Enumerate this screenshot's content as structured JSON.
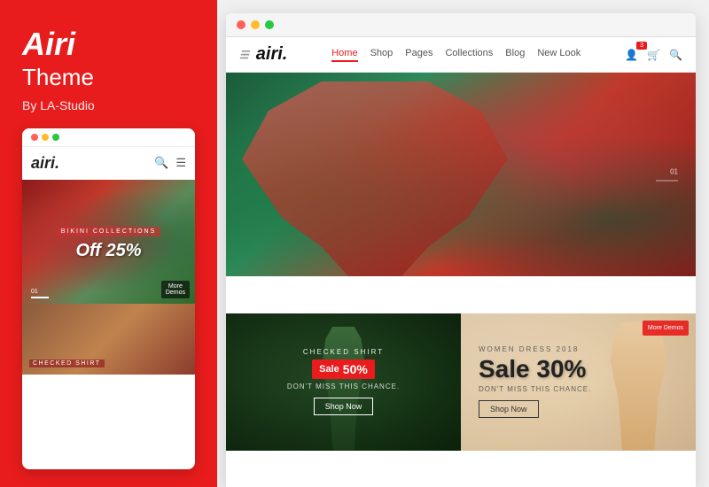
{
  "sidebar": {
    "title": "Airi",
    "subtitle": "Theme",
    "author": "By LA-Studio",
    "mobile_preview": {
      "dots": [
        "red",
        "yellow",
        "green"
      ],
      "logo": "airi.",
      "hero": {
        "collection_label": "BIKINI COLLECTIONS",
        "title": "Off 25%",
        "more_demos": "More\nDemos"
      },
      "bottom_label": "CHECKED SHIRT"
    }
  },
  "desktop": {
    "browser_dots": [
      "red",
      "yellow",
      "green"
    ],
    "nav": {
      "logo": "airi.",
      "links": [
        "Home",
        "Shop",
        "Pages",
        "Collections",
        "Blog",
        "New Look"
      ],
      "active_link": "Home",
      "cart_badge": "3",
      "icons": [
        "user",
        "cart",
        "search"
      ]
    },
    "hero": {
      "pagination": {
        "number": "01",
        "line": true
      }
    },
    "product_left": {
      "tag": "CHECKED SHIRT",
      "sale_label": "Sale",
      "sale_percent": "50%",
      "sub_text": "DON'T MISS THIS CHANCE.",
      "btn_label": "Shop Now"
    },
    "product_right": {
      "tag": "Women Dress 2018",
      "sale_large": "Sale 30%",
      "sub_text": "DON'T MISS THIS CHANCE.",
      "btn_label": "Shop Now",
      "more_demos": "More\nDemos"
    }
  }
}
